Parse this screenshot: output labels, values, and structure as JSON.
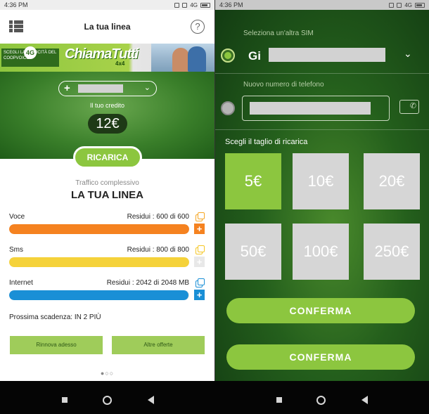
{
  "left": {
    "status": {
      "time": "4:36 PM",
      "network": "4G"
    },
    "header": {
      "title": "La tua linea",
      "help_glyph": "?"
    },
    "banner": {
      "tag_text": "SCEGLI LA VELOCITÀ DEL COOPVOICE",
      "tag_badge": "4G",
      "brand": "ChiamaTutti",
      "brand_sub": "4x4"
    },
    "line_selector": {
      "plus_glyph": "+",
      "chevron_glyph": "⌄"
    },
    "credit": {
      "label": "Il tuo credito",
      "value": "12€"
    },
    "ricarica_label": "RICARICA",
    "traffic": {
      "subtitle": "Traffico complessivo",
      "title": "LA TUA LINEA"
    },
    "usage": [
      {
        "label": "Voce",
        "residual": "Residui : 600 di 600",
        "fraction": 1.0,
        "color": "#f58220",
        "icon_color": "#f5a623"
      },
      {
        "label": "Sms",
        "residual": "Residui : 800 di 800",
        "fraction": 1.0,
        "color": "#f5d23a",
        "icon_color": "#f5c623"
      },
      {
        "label": "Internet",
        "residual": "Residui : 2042 di 2048 MB",
        "fraction": 0.997,
        "color": "#1a8fd6",
        "icon_color": "#1a8fd6"
      }
    ],
    "expiry": "Prossima scadenza: IN 2 PIÙ",
    "buttons": {
      "renew": "Rinnova adesso",
      "offers": "Altre offerte"
    },
    "pager": "●○○"
  },
  "right": {
    "status": {
      "time": "4:36 PM",
      "network": "4G"
    },
    "sim_label": "Seleziona un'altra SIM",
    "sim_name": "Gi",
    "sim_chevron": "⌄",
    "phone_label": "Nuovo numero di telefono",
    "phone_icon": "✆",
    "cut_label": "Scegli il taglio di ricarica",
    "amounts": [
      "5€",
      "10€",
      "20€",
      "50€",
      "100€",
      "250€"
    ],
    "selected_amount": "5€",
    "confirm_label": "CONFERMA"
  },
  "colors": {
    "accent_green": "#8cc63f",
    "dark_green": "#245f1c",
    "voce": "#f58220",
    "sms": "#f5d23a",
    "internet": "#1a8fd6"
  }
}
